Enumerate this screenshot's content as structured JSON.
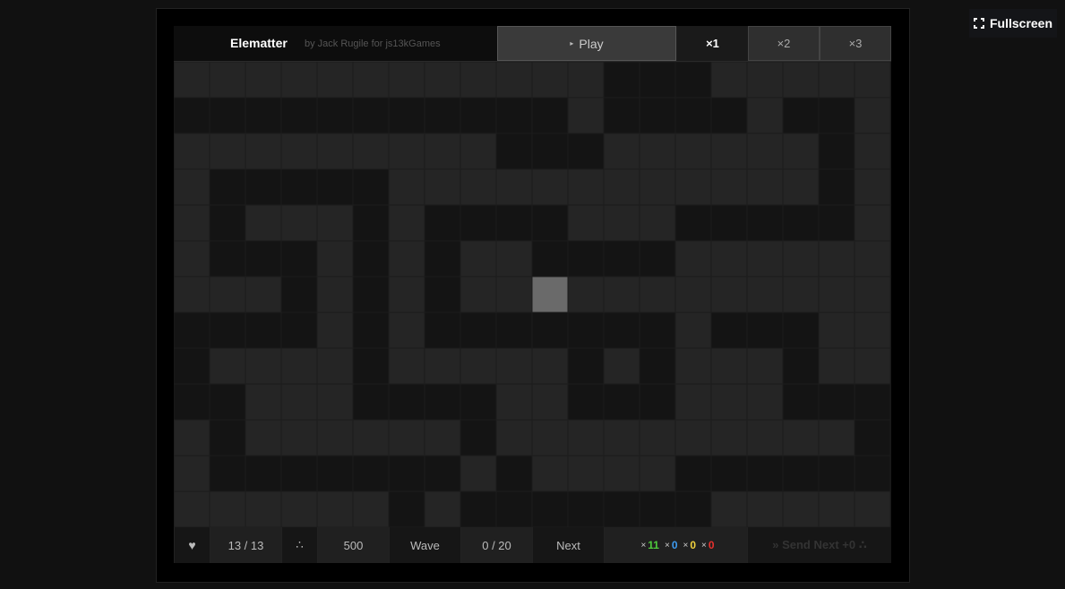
{
  "fullscreen": {
    "label": "Fullscreen"
  },
  "game": {
    "title": "Elematter",
    "author": "by Jack Rugile for js13kGames"
  },
  "controls": {
    "play_icon": "▸",
    "play_label": "Play",
    "speeds": [
      "×1",
      "×2",
      "×3"
    ],
    "active_speed": "×1"
  },
  "status": {
    "lives_icon": "♥",
    "lives": "13 / 13",
    "gold_icon": "∴",
    "gold": "500",
    "wave_label": "Wave",
    "wave": "0 / 20",
    "next_label": "Next",
    "gems": [
      {
        "prefix": "×",
        "value": "11",
        "color": "#4ecb3c"
      },
      {
        "prefix": "×",
        "value": "0",
        "color": "#3d9bf0"
      },
      {
        "prefix": "×",
        "value": "0",
        "color": "#f0d13d"
      },
      {
        "prefix": "×",
        "value": "0",
        "color": "#e8312d"
      }
    ],
    "send_next": "» Send Next +0 ∴"
  },
  "board": {
    "cols": 20,
    "rows": 13,
    "colors": {
      "wall": "#252525",
      "path": "#141414",
      "cursor": "#6a6a6a",
      "grid": "#1c1c1c"
    },
    "grid": [
      "WWWWWWWWWWWW...WWWWW",
      "...........W....W..W",
      "WWWWWWWWW...WWWWWW.W",
      "W.....WWWWWWWWWWWW.W",
      "W.WWW.W....WWW.....W",
      "W...W.W.WW....WWWWWW",
      "WWW.W.W.WWCWWWWWWWWW",
      "....W.W.......W...WW",
      ".WWWW.WWWWW.W.WWW.WW",
      "..WWW....WW...WWW...",
      "W.WWWWWW.WWWWWWWWWW.",
      "W.......W.WWWW......",
      "WWWWWW.W.......WWWWW"
    ]
  }
}
